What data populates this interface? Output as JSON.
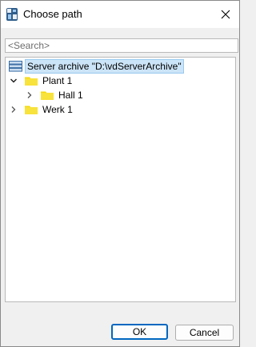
{
  "window": {
    "title": "Choose path"
  },
  "search": {
    "placeholder": "<Search>",
    "value": ""
  },
  "tree": {
    "nodes": [
      {
        "label": "Server archive \"D:\\vdServerArchive\"",
        "icon": "database-icon",
        "selected": true
      },
      {
        "label": "Plant 1",
        "icon": "folder-icon",
        "expanded": true
      },
      {
        "label": "Hall 1",
        "icon": "folder-icon",
        "expanded": false
      },
      {
        "label": "Werk 1",
        "icon": "folder-icon",
        "expanded": false
      }
    ]
  },
  "buttons": {
    "ok_label": "OK",
    "cancel_label": "Cancel"
  },
  "colors": {
    "folder": "#f5d90a",
    "selection": "#cce4f7",
    "default_button_border": "#0067c0"
  }
}
